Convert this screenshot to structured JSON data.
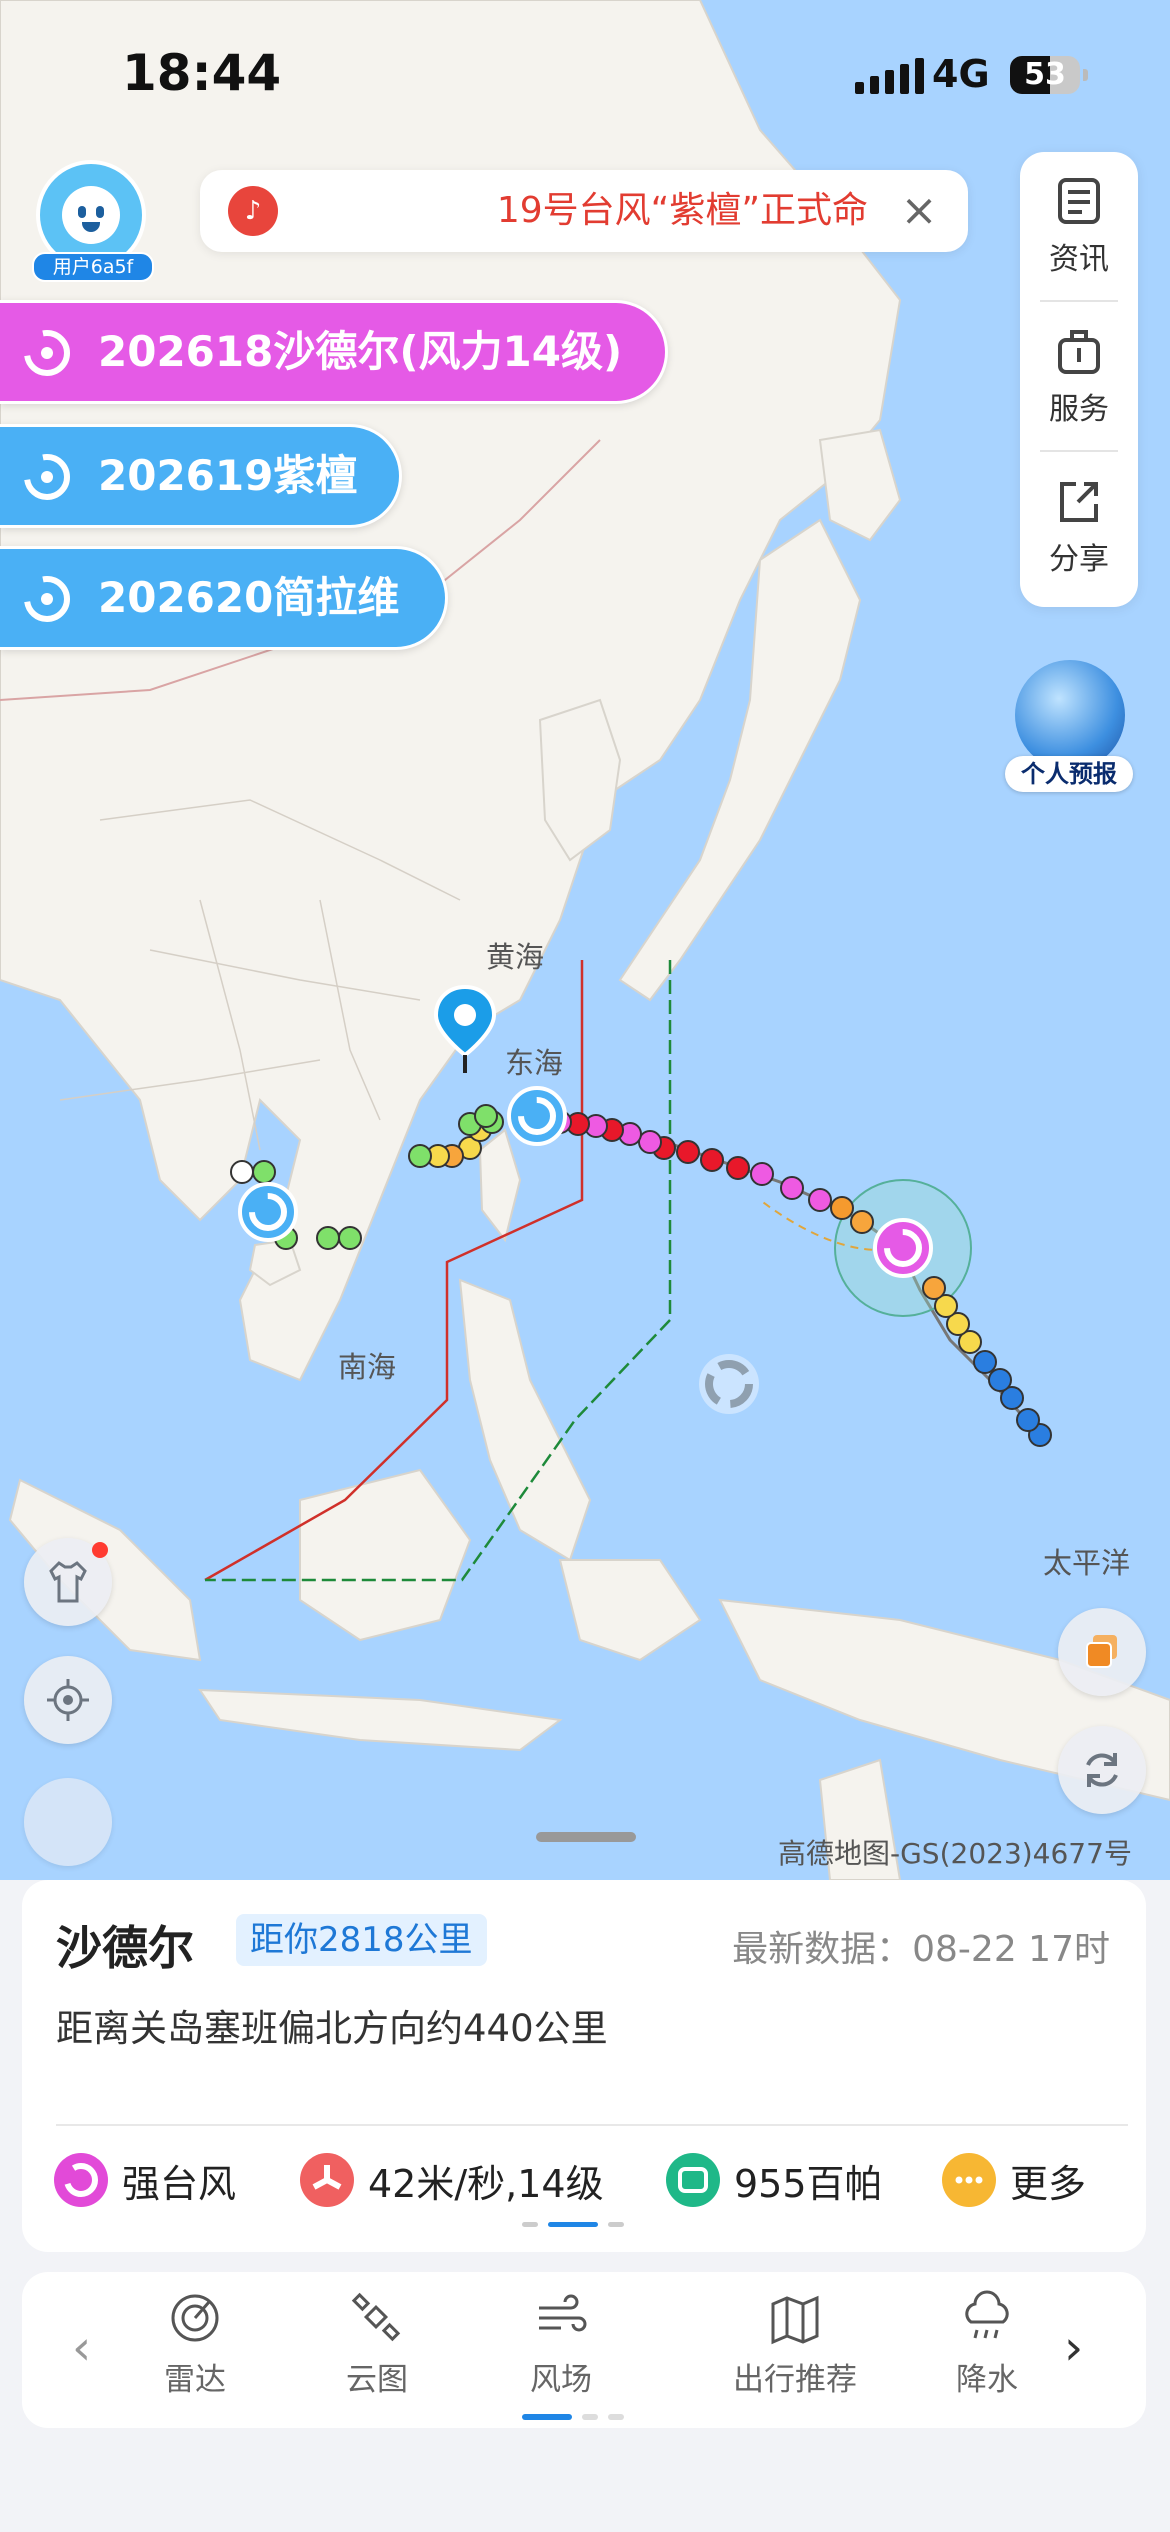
{
  "status_bar": {
    "time": "18:44",
    "network": "4G",
    "battery": "53"
  },
  "user": {
    "tag": "用户6a5f"
  },
  "notice": {
    "text": "19号台风“紫檀”正式命",
    "icon": "speaker-icon",
    "close": "×"
  },
  "sidebar": {
    "items": [
      {
        "label": "资讯",
        "icon": "news-icon"
      },
      {
        "label": "服务",
        "icon": "service-icon"
      },
      {
        "label": "分享",
        "icon": "share-icon"
      }
    ]
  },
  "typhoons": [
    {
      "label": "202618沙德尔(风力14级)",
      "color": "#e55ae6"
    },
    {
      "label": "202619紫檀",
      "color": "#4ab0f5"
    },
    {
      "label": "202620简拉维",
      "color": "#4ab0f5"
    }
  ],
  "personal_forecast": {
    "label": "个人预报"
  },
  "map": {
    "labels": {
      "yellow_sea": "黄海",
      "east_sea": "东海",
      "south_sea": "南海",
      "pacific": "太平洋"
    },
    "attribution": "高德地图-GS(2023)4677号"
  },
  "detail": {
    "name": "沙德尔",
    "distance": "距你2818公里",
    "updated": "最新数据：08-22 17时",
    "location": "距离关岛塞班偏北方向约440公里",
    "stats": [
      {
        "label": "强台风",
        "icon": "typhoon-level-icon",
        "color": "#e24ad8"
      },
      {
        "label": "42米/秒,14级",
        "icon": "wind-speed-icon",
        "color": "#f06060"
      },
      {
        "label": "955百帕",
        "icon": "pressure-icon",
        "color": "#1fb888"
      },
      {
        "label": "更多",
        "icon": "more-icon",
        "color": "#f7b733"
      }
    ]
  },
  "tabs": [
    {
      "label": "雷达",
      "icon": "radar-icon"
    },
    {
      "label": "云图",
      "icon": "satellite-icon"
    },
    {
      "label": "风场",
      "icon": "wind-field-icon"
    },
    {
      "label": "出行推荐",
      "icon": "map-route-icon"
    },
    {
      "label": "降水",
      "icon": "rain-icon"
    }
  ]
}
